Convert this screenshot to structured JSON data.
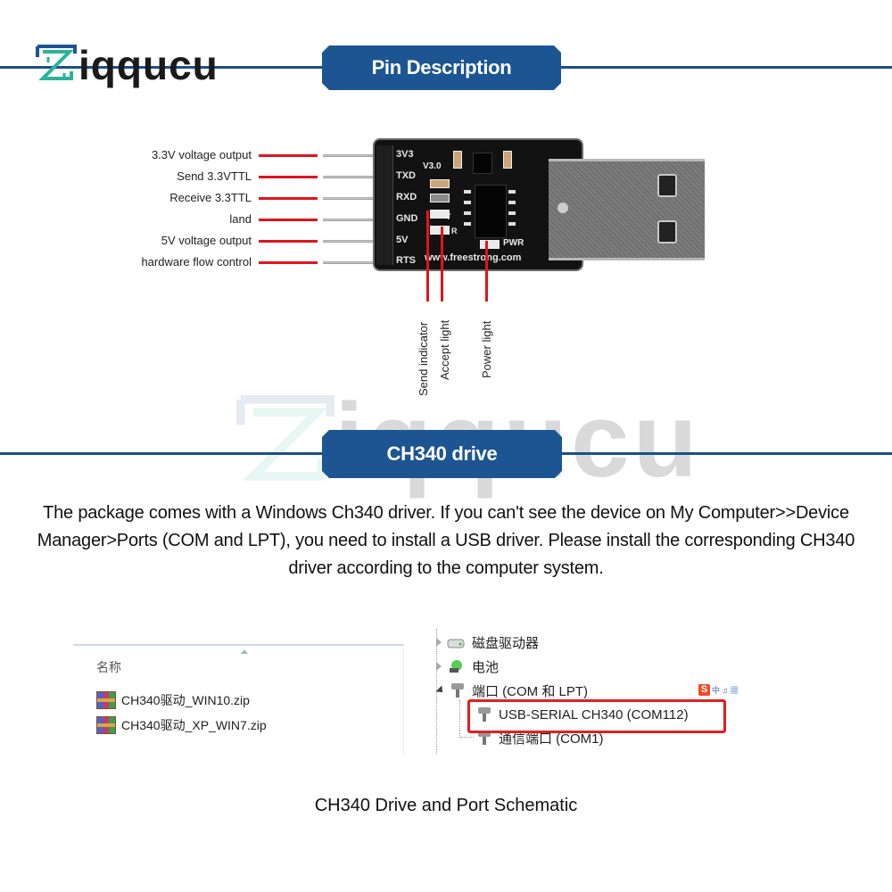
{
  "brand": {
    "logo_text": "iqqucu",
    "logo_initial": "Z",
    "primary_color": "#1c5592",
    "accent_teal": "#2bb39a"
  },
  "sections": {
    "pin_description": {
      "title": "Pin Description"
    },
    "ch340_drive": {
      "title": "CH340 drive"
    }
  },
  "pins": [
    {
      "label": "3.3V voltage output",
      "silk": "3V3"
    },
    {
      "label": "Send 3.3VTTL",
      "silk": "TXD"
    },
    {
      "label": "Receive 3.3TTL",
      "silk": "RXD"
    },
    {
      "label": "land",
      "silk": "GND"
    },
    {
      "label": "5V voltage output",
      "silk": "5V"
    },
    {
      "label": "hardware flow control",
      "silk": "RTS"
    }
  ],
  "board": {
    "version": "V3.0",
    "website": "www.freestrong.com",
    "pwr_silk": "PWR",
    "t_silk": "T",
    "r_silk": "R"
  },
  "indicators": [
    {
      "label": "Send indicator"
    },
    {
      "label": "Accept light"
    },
    {
      "label": "Power light"
    }
  ],
  "description": "The package comes with a Windows Ch340 driver. If you can't see the device on My Computer>>Device Manager>Ports (COM and LPT), you need to install a USB driver. Please install the corresponding CH340 driver according to the computer system.",
  "explorer": {
    "column_header": "名称",
    "files": [
      {
        "name": "CH340驱动_WIN10.zip",
        "icon": "winrar-archive-icon"
      },
      {
        "name": "CH340驱动_XP_WIN7.zip",
        "icon": "winrar-archive-icon"
      }
    ]
  },
  "device_manager": {
    "items": [
      {
        "label": "磁盘驱动器",
        "expanded": false,
        "icon": "disk-drive-icon"
      },
      {
        "label": "电池",
        "expanded": false,
        "icon": "battery-icon"
      },
      {
        "label": "端口 (COM 和 LPT)",
        "expanded": true,
        "icon": "port-icon",
        "children": [
          {
            "label": "USB-SERIAL CH340 (COM112)",
            "highlighted": true
          },
          {
            "label": "通信端口 (COM1)",
            "highlighted": false
          }
        ]
      }
    ],
    "ime_badge": {
      "s": "S",
      "rest": "中 ♫ ▦"
    },
    "highlight_color": "#e02020"
  },
  "caption": "CH340 Drive and Port Schematic"
}
